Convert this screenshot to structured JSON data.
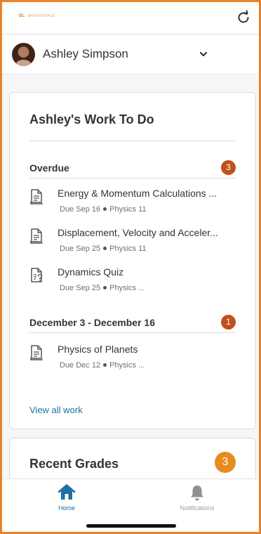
{
  "header": {
    "logo_mark": "BL",
    "logo_word": "BRIGHTSPACE"
  },
  "user": {
    "name": "Ashley Simpson"
  },
  "work": {
    "title": "Ashley's Work To Do",
    "sections": [
      {
        "label": "Overdue",
        "count": "3",
        "items": [
          {
            "title": "Energy & Momentum Calculations ...",
            "due": "Due Sep 16",
            "course": "Physics 11",
            "icon": "assignment-icon"
          },
          {
            "title": "Displacement, Velocity and Acceler...",
            "due": "Due Sep 25",
            "course": "Physics 11",
            "icon": "assignment-icon"
          },
          {
            "title": "Dynamics Quiz",
            "due": "Due Sep 25",
            "course": "Physics ...",
            "icon": "quiz-icon"
          }
        ]
      },
      {
        "label": "December 3 - December 16",
        "count": "1",
        "items": [
          {
            "title": "Physics of Planets",
            "due": "Due Dec 12",
            "course": "Physics ...",
            "icon": "assignment-icon"
          }
        ]
      }
    ],
    "view_all": "View all work"
  },
  "grades": {
    "title": "Recent Grades",
    "count": "3"
  },
  "nav": {
    "home": "Home",
    "notifications": "Notifications"
  },
  "colors": {
    "accent": "#1e6fa8",
    "overdue_badge": "#c0501c",
    "grades_badge": "#e88b1f",
    "frame": "#e8822a"
  }
}
